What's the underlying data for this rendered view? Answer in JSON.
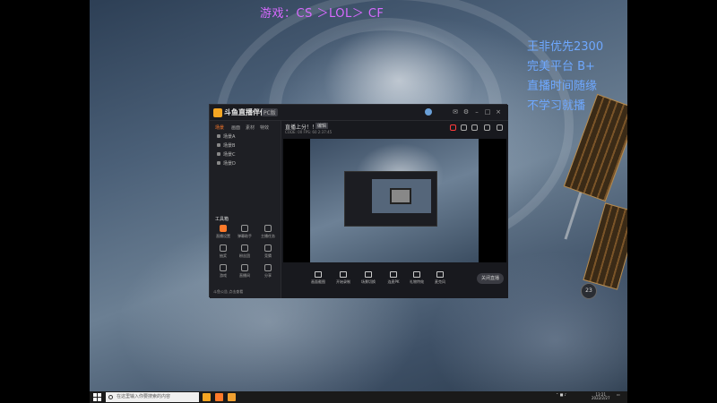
{
  "overlay": {
    "title": "游戏：CS ＞LOL＞ CF",
    "right_lines": [
      "王非优先2300",
      "完美平台 B+",
      "直播时间随缘",
      "不学习就播"
    ]
  },
  "app": {
    "brand": "斗鱼直播伴侣",
    "brand_tag": "PC版",
    "sidebar_tabs": [
      "场景",
      "画面",
      "素材",
      "特效"
    ],
    "scenes": [
      "场景A",
      "场景B",
      "场景C",
      "场景D"
    ],
    "tools_title": "工具箱",
    "tools": [
      "直播设置",
      "弹幕助手",
      "主播任务",
      "抽奖",
      "粉丝团",
      "竞猜",
      "游戏",
      "直播间",
      "分享"
    ],
    "sidebar_bottom": "斗鱼公告  点击查看",
    "main_title": "直播上分！！！",
    "main_badge": "编辑",
    "main_stats": "CODE: 00   FPS: 60   2:37:45",
    "controls": [
      "画面截图",
      "开始录制",
      "场景切换",
      "连麦PK",
      "礼物特效",
      "麦克风"
    ],
    "go_live": "关闭直播"
  },
  "taskbar": {
    "search_placeholder": "在这里输入你要搜索的内容",
    "time": "13:21",
    "date": "2022/2/27"
  },
  "badge": "23"
}
